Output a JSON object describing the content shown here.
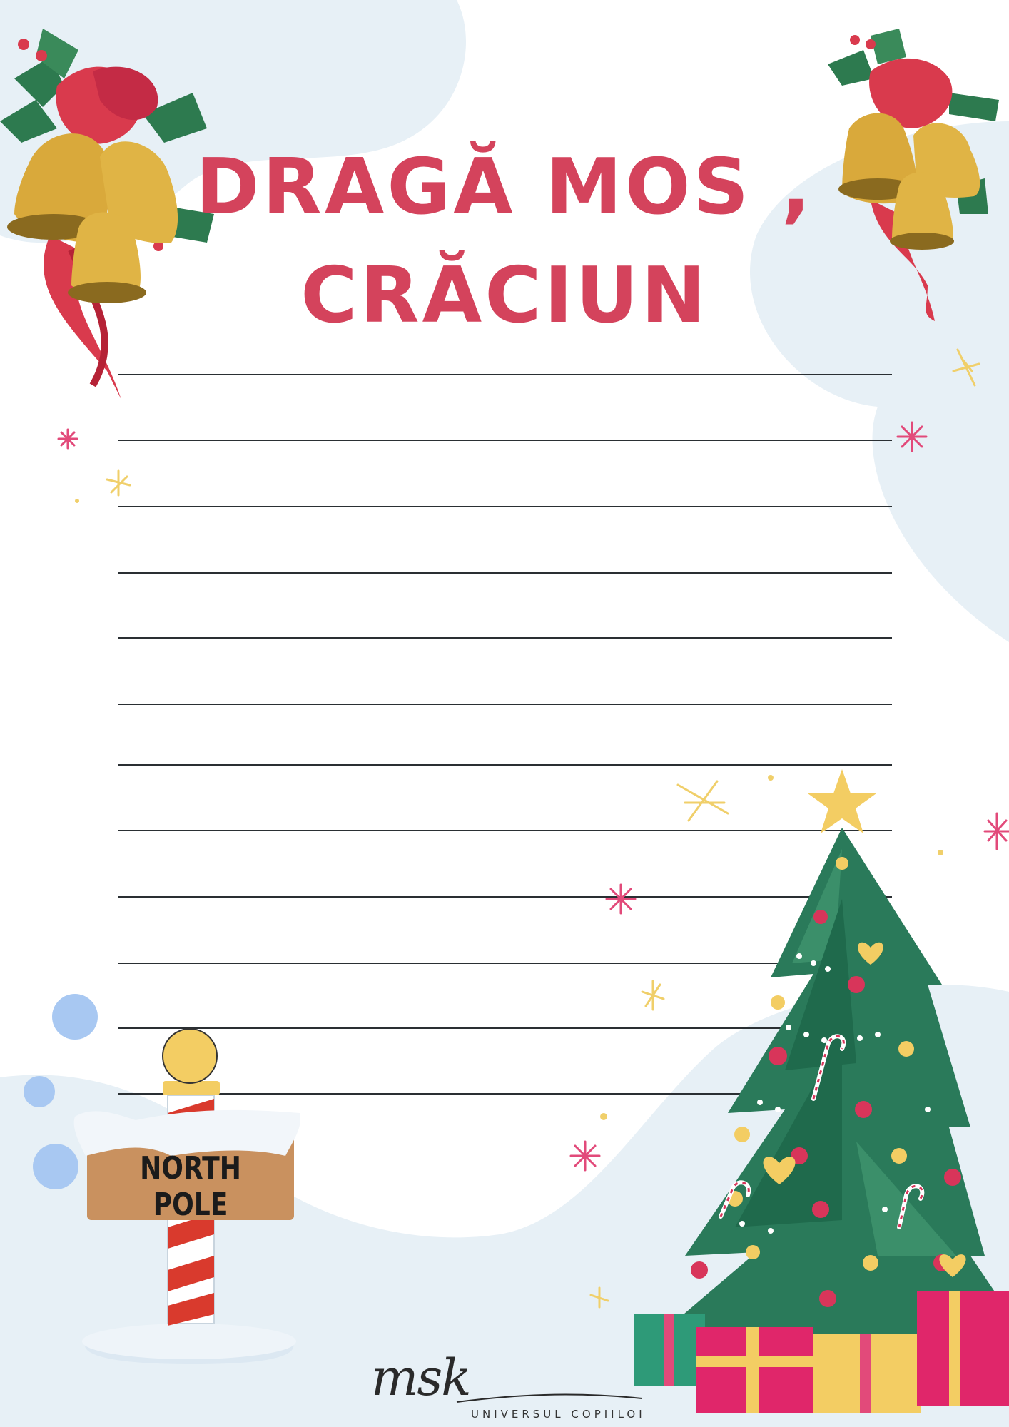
{
  "title": {
    "line1": "DRAGĂ MOS ,",
    "line2": "CRĂCIUN"
  },
  "sign": {
    "label": "NORTH POLE"
  },
  "logo": {
    "script": "msk",
    "subtitle": "UNIVERSUL COPIILOI"
  },
  "writing_lines_count": 12,
  "colors": {
    "title": "#d4435c",
    "blob": "#e7f0f6",
    "line": "#2a2f33",
    "tree": "#2a7a5a",
    "gold": "#f3cd63",
    "pink": "#e24a7a"
  },
  "icons": [
    "bells-icon",
    "holly-icon",
    "christmas-tree-icon",
    "star-icon",
    "gift-icon",
    "north-pole-sign-icon",
    "sparkle-icon"
  ]
}
